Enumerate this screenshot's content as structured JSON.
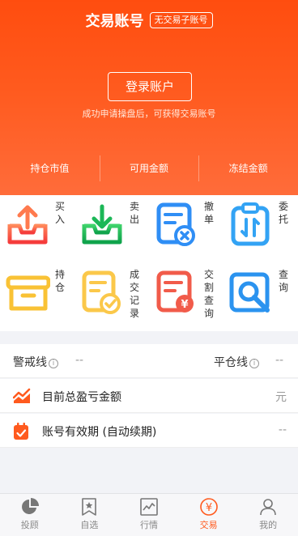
{
  "header": {
    "title": "交易账号",
    "no_account_tag": "无交易子账号",
    "login_button": "登录账户",
    "hint": "成功申请操盘后，可获得交易账号",
    "stats": [
      "持仓市值",
      "可用金额",
      "冻结金额"
    ]
  },
  "grid": [
    {
      "label": "买入",
      "icon": "buy-icon"
    },
    {
      "label": "卖出",
      "icon": "sell-icon"
    },
    {
      "label": "撤单",
      "icon": "cancel-order-icon"
    },
    {
      "label": "委托",
      "icon": "entrust-icon"
    },
    {
      "label": "持仓",
      "icon": "position-icon"
    },
    {
      "label": "成交记录",
      "icon": "deal-record-icon"
    },
    {
      "label": "交割查询",
      "icon": "settlement-query-icon"
    },
    {
      "label": "查询",
      "icon": "query-icon"
    }
  ],
  "lines": {
    "warning_label": "警戒线",
    "warning_value": "--",
    "close_label": "平仓线",
    "close_value": "--"
  },
  "profit": {
    "label": "目前总盈亏金额",
    "unit": "元"
  },
  "validity": {
    "label": "账号有效期 (自动续期)",
    "value": "--"
  },
  "tabs": [
    {
      "label": "投顾",
      "icon": "advisor-icon"
    },
    {
      "label": "自选",
      "icon": "watchlist-icon"
    },
    {
      "label": "行情",
      "icon": "market-icon"
    },
    {
      "label": "交易",
      "icon": "trade-icon",
      "active": true
    },
    {
      "label": "我的",
      "icon": "profile-icon"
    }
  ],
  "colors": {
    "accent": "#ff5a1e",
    "header_top": "#ff4d0f",
    "header_bottom": "#ff6c3a"
  }
}
